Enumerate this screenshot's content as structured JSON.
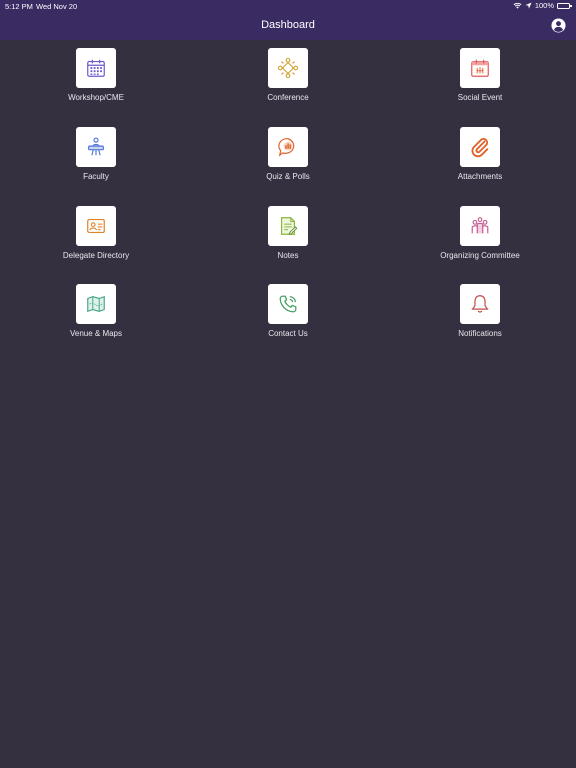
{
  "status_bar": {
    "time": "5:12 PM",
    "date": "Wed Nov 20",
    "battery": "100%"
  },
  "nav": {
    "title": "Dashboard"
  },
  "tiles": [
    {
      "label": "Workshop/CME",
      "icon": "calendar-icon",
      "color": "#6a5acd"
    },
    {
      "label": "Conference",
      "icon": "conference-group-icon",
      "color": "#d4a02a"
    },
    {
      "label": "Social Event",
      "icon": "social-calendar-icon",
      "color": "#e05a5a"
    },
    {
      "label": "Faculty",
      "icon": "faculty-lectern-icon",
      "color": "#4a6fd4"
    },
    {
      "label": "Quiz & Polls",
      "icon": "poll-bubble-icon",
      "color": "#e0622a"
    },
    {
      "label": "Attachments",
      "icon": "paperclip-icon",
      "color": "#e0622a"
    },
    {
      "label": "Delegate Directory",
      "icon": "id-card-icon",
      "color": "#e0822a"
    },
    {
      "label": "Notes",
      "icon": "notes-icon",
      "color": "#8ab83a"
    },
    {
      "label": "Organizing Committee",
      "icon": "committee-people-icon",
      "color": "#c0508a"
    },
    {
      "label": "Venue & Maps",
      "icon": "map-icon",
      "color": "#4aa88a"
    },
    {
      "label": "Contact Us",
      "icon": "phone-icon",
      "color": "#3a9a5a"
    },
    {
      "label": "Notifications",
      "icon": "bell-icon",
      "color": "#c04a4a"
    }
  ],
  "colors": {
    "header": "#3b2b63",
    "background": "#35303f",
    "tile": "#ffffff"
  }
}
